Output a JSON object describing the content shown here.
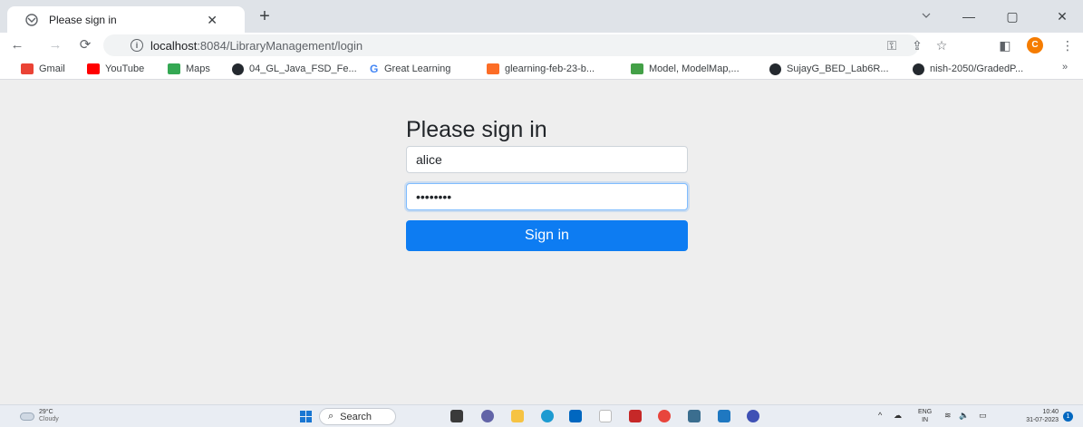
{
  "browser": {
    "tab_title": "Please sign in",
    "tab_close": "✕",
    "new_tab": "+",
    "window_controls": {
      "minimize": "—",
      "restore": "▢",
      "close": "✕"
    },
    "url_host": "localhost",
    "url_rest": ":8084/LibraryManagement/login",
    "profile_initial": "C",
    "bookmarks": [
      {
        "label": "Gmail",
        "color": "#ea4335"
      },
      {
        "label": "YouTube",
        "color": "#ff0000"
      },
      {
        "label": "Maps",
        "color": "#34a853"
      },
      {
        "label": "04_GL_Java_FSD_Fe...",
        "color": "#24292f"
      },
      {
        "label": "Great Learning",
        "color": "#4285f4"
      },
      {
        "label": "glearning-feb-23-b...",
        "color": "#fc6d26"
      },
      {
        "label": "Model, ModelMap,...",
        "color": "#43a047"
      },
      {
        "label": "SujayG_BED_Lab6R...",
        "color": "#24292f"
      },
      {
        "label": "nish-2050/GradedP...",
        "color": "#24292f"
      }
    ],
    "bookmarks_more": "»"
  },
  "login": {
    "heading": "Please sign in",
    "username_value": "alice",
    "password_value": "••••••••",
    "submit_label": "Sign in",
    "button_color": "#0d7cf2"
  },
  "taskbar": {
    "weather_temp": "29°C",
    "weather_condition": "Cloudy",
    "search_label": "Search",
    "lang_top": "ENG",
    "lang_bottom": "IN",
    "time": "10:40",
    "date": "31-07-2023",
    "notification_count": "1"
  }
}
